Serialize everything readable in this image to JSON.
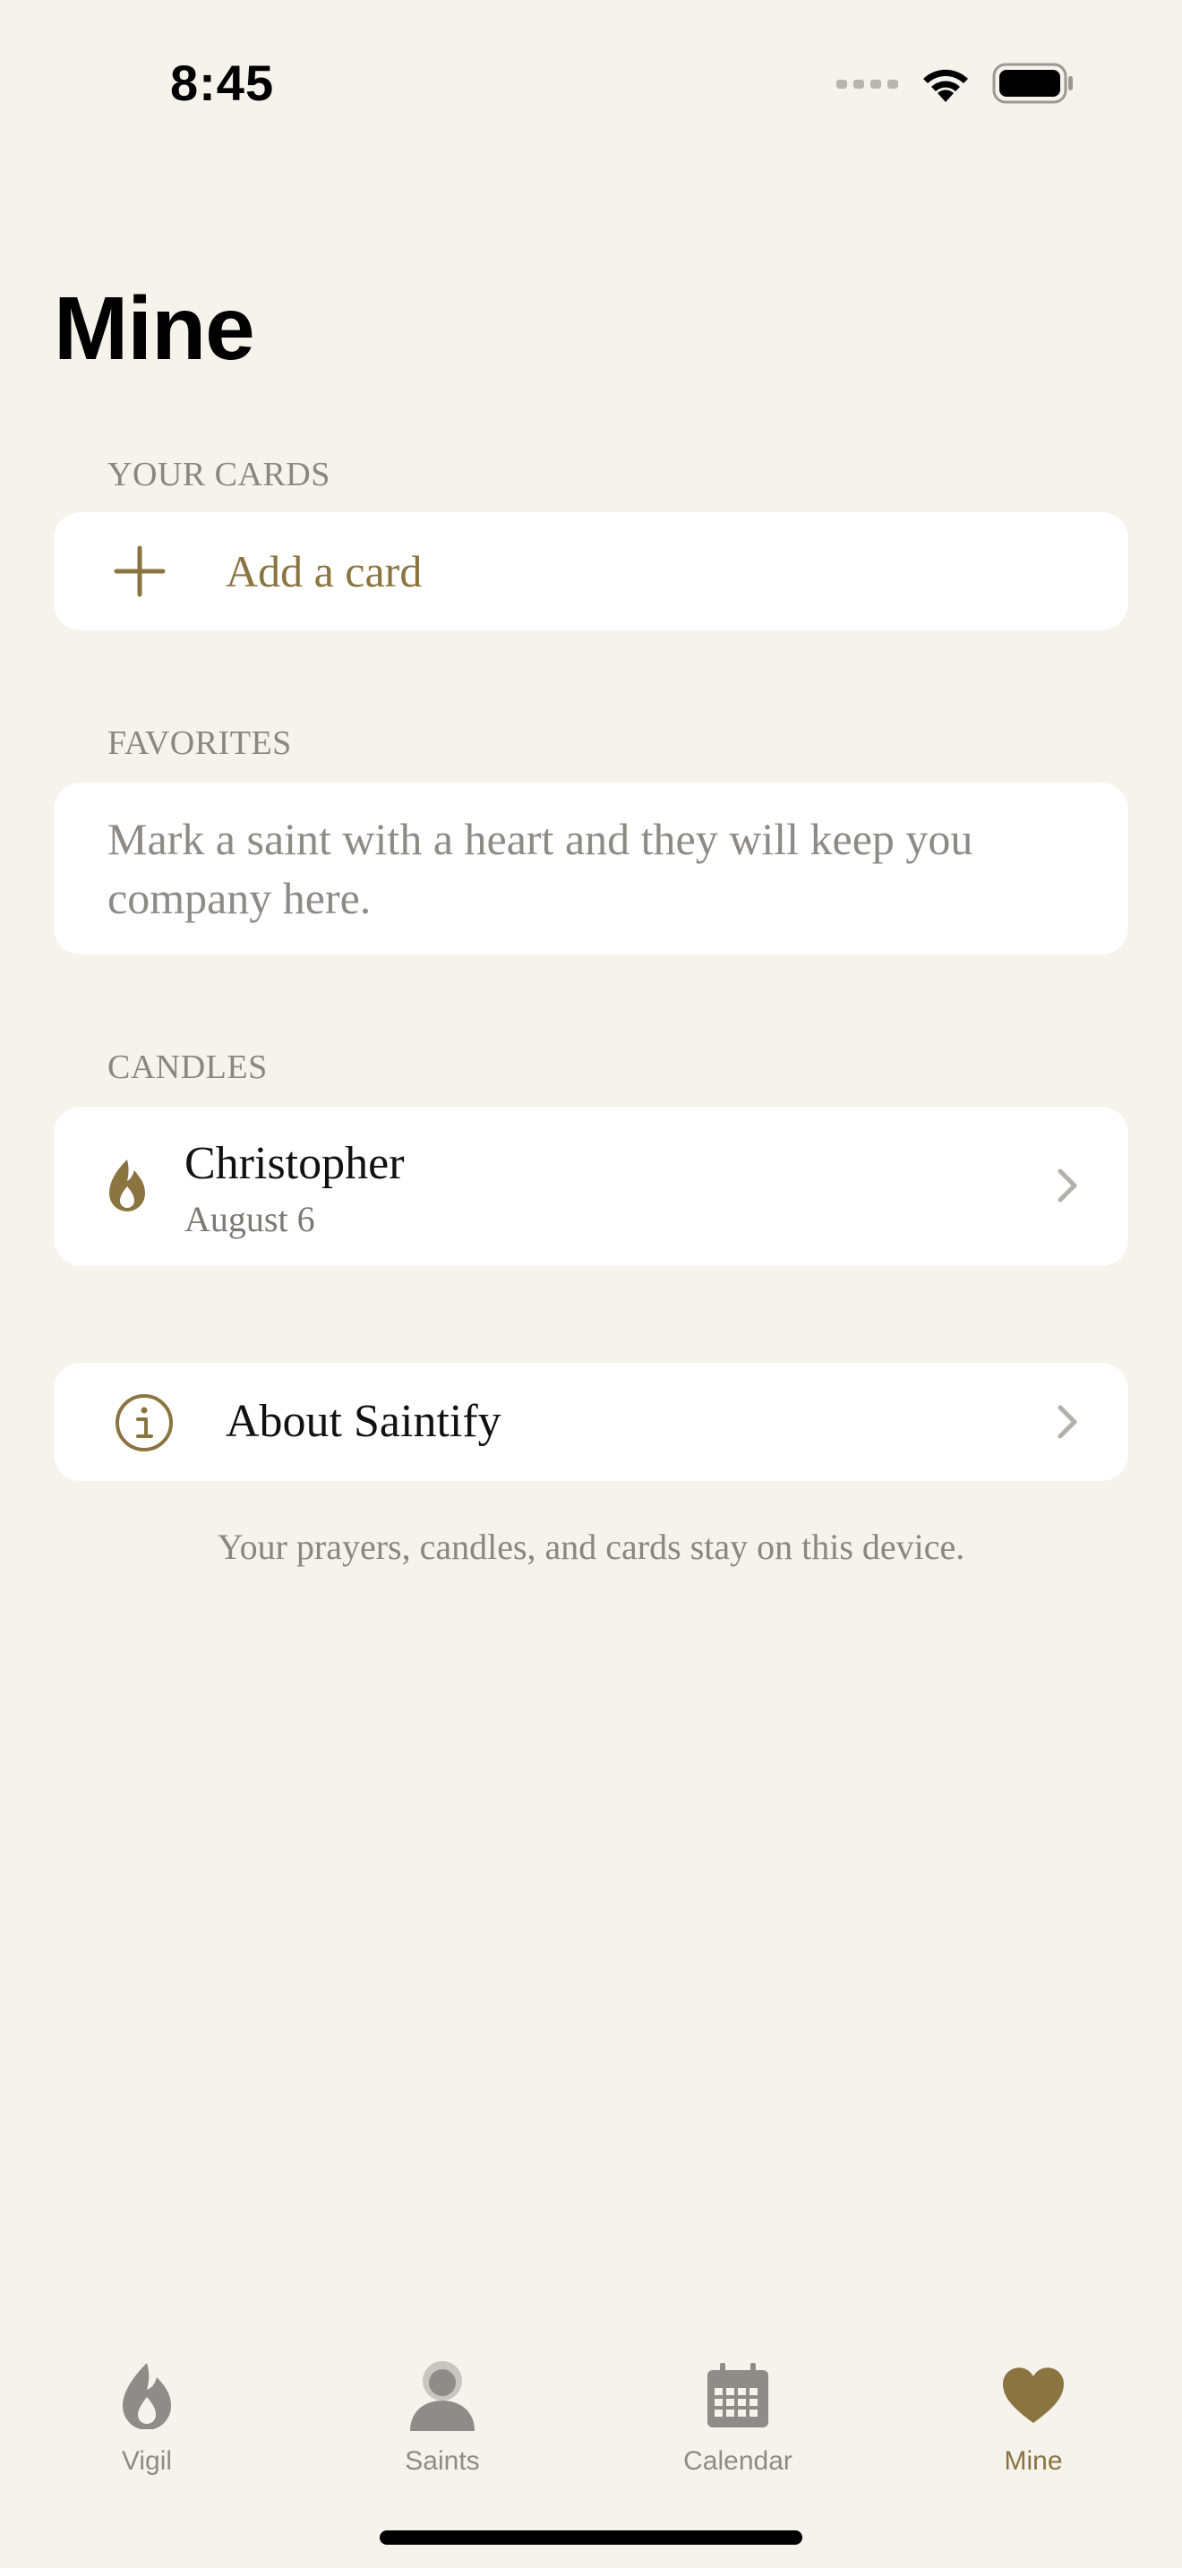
{
  "status_bar": {
    "time": "8:45",
    "icons": [
      "signal-icon",
      "wifi-icon",
      "battery-icon"
    ]
  },
  "page": {
    "title": "Mine"
  },
  "cards_section": {
    "label": "YOUR CARDS",
    "add_label": "Add a card",
    "icon": "plus-icon"
  },
  "favorites_section": {
    "label": "FAVORITES",
    "empty_text": "Mark a saint with a heart and they will keep you company here."
  },
  "candles_section": {
    "label": "CANDLES",
    "items": [
      {
        "name": "Christopher",
        "date": "August 6",
        "icon": "flame-icon"
      }
    ]
  },
  "about": {
    "label": "About Saintify",
    "icon": "info-icon"
  },
  "footnote": "Your prayers, candles, and cards stay on this device.",
  "tabbar": {
    "tabs": [
      {
        "label": "Vigil",
        "icon": "flame-icon",
        "active": false
      },
      {
        "label": "Saints",
        "icon": "person-icon",
        "active": false
      },
      {
        "label": "Calendar",
        "icon": "calendar-icon",
        "active": false
      },
      {
        "label": "Mine",
        "icon": "heart-icon",
        "active": true
      }
    ]
  },
  "colors": {
    "background": "#F6F2EC",
    "card": "#FFFFFF",
    "accent": "#8A7440",
    "secondary_text": "#8A8681",
    "inactive_tab": "#8E8C88"
  }
}
